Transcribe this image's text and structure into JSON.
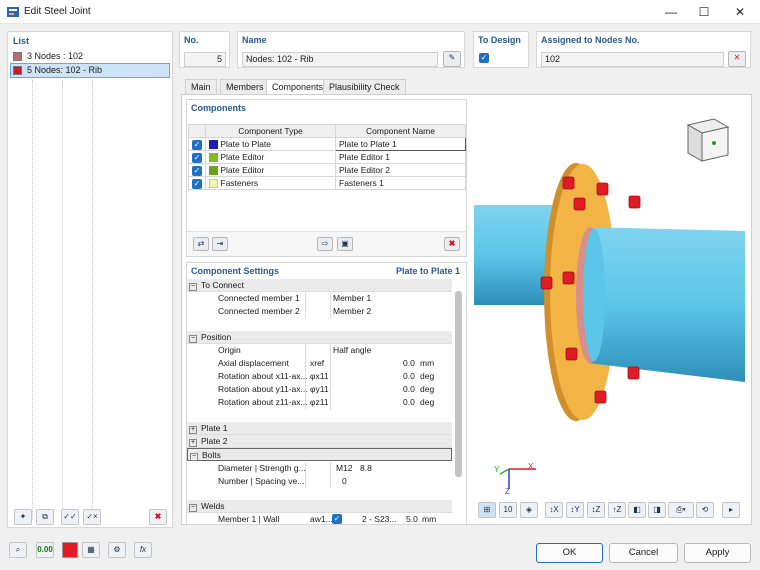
{
  "window": {
    "title": "Edit Steel Joint"
  },
  "list": {
    "heading": "List",
    "items": [
      {
        "label": "3 Nodes : 102",
        "color": "#c06a6a"
      },
      {
        "label": "5 Nodes: 102 - Rib",
        "color": "#c81e2a"
      }
    ]
  },
  "header": {
    "no_label": "No.",
    "no_value": "5",
    "name_label": "Name",
    "name_value": "Nodes: 102 - Rib",
    "to_design_label": "To Design",
    "assigned_label": "Assigned to Nodes No.",
    "assigned_value": "102"
  },
  "tabs": [
    "Main",
    "Members",
    "Components",
    "Plausibility Check"
  ],
  "components": {
    "heading": "Components",
    "columns": [
      "Component Type",
      "Component Name"
    ],
    "rows": [
      {
        "type": "Plate to Plate",
        "name": "Plate to Plate 1",
        "color": "#1d1db8"
      },
      {
        "type": "Plate Editor",
        "name": "Plate Editor 1",
        "color": "#7dbb22"
      },
      {
        "type": "Plate Editor",
        "name": "Plate Editor 2",
        "color": "#6aa31e"
      },
      {
        "type": "Fasteners",
        "name": "Fasteners 1",
        "color": "#f2f6b0"
      }
    ]
  },
  "settings": {
    "heading": "Component Settings",
    "current": "Plate to Plate 1",
    "to_connect": "To Connect",
    "connected_member_1": "Connected member 1",
    "member_1": "Member 1",
    "connected_member_2": "Connected member 2",
    "member_2": "Member 2",
    "position": "Position",
    "origin": "Origin",
    "origin_value": "Half angle",
    "axial": "Axial displacement",
    "axial_sym": "xref",
    "axial_val": "0.0",
    "axial_unit": "mm",
    "rot_x": "Rotation about x11-ax...",
    "rot_x_sym": "φx11",
    "rot_x_val": "0.0",
    "rot_x_unit": "deg",
    "rot_y": "Rotation about y11-ax...",
    "rot_y_sym": "φy11",
    "rot_y_val": "0.0",
    "rot_y_unit": "deg",
    "rot_z": "Rotation about z11-ax...",
    "rot_z_sym": "φz11",
    "rot_z_val": "0.0",
    "rot_z_unit": "deg",
    "plate1": "Plate 1",
    "plate2": "Plate 2",
    "bolts": "Bolts",
    "diameter": "Diameter | Strength g...",
    "diameter_val": "M12",
    "strength_val": "8.8",
    "number": "Number | Spacing ve...",
    "number_val": "0",
    "welds": "Welds",
    "weld_member": "Member 1 | Wall",
    "weld_sym": "aw1...",
    "weld_type": "2 - S23...",
    "weld_val": "5.0",
    "weld_unit": "mm"
  },
  "axes": {
    "x": "X",
    "y": "Y",
    "z": "Z"
  },
  "buttons": {
    "ok": "OK",
    "cancel": "Cancel",
    "apply": "Apply",
    "number_display": "0.00"
  },
  "colors": {
    "accent": "#1f6fc5",
    "pipe": "#5cc6e8",
    "plate": "#f3b446",
    "bolt": "#e01b24"
  }
}
